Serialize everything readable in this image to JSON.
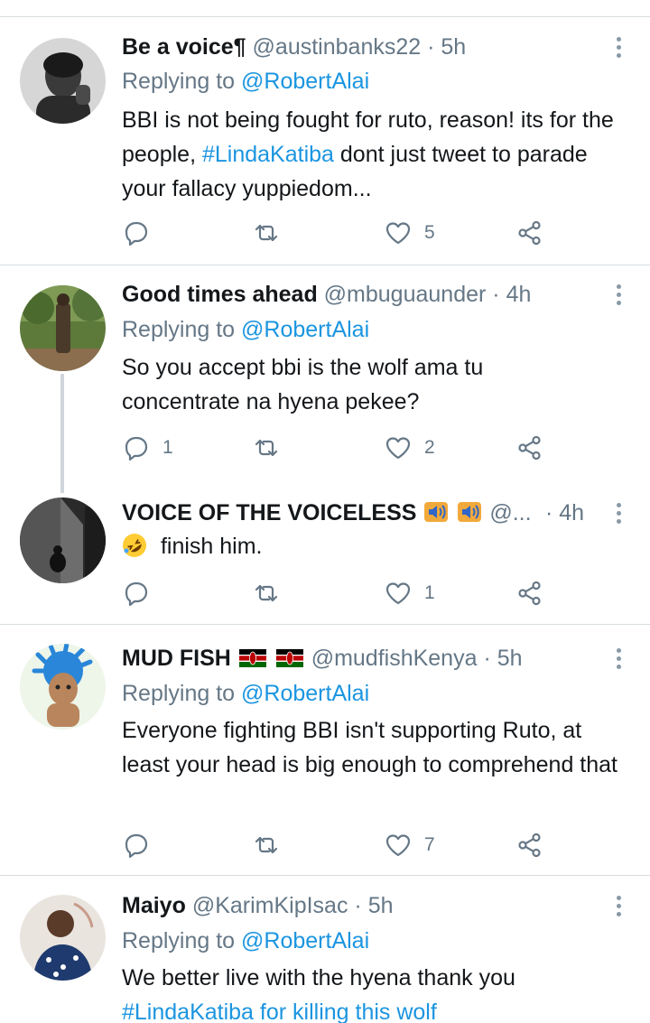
{
  "tweets": [
    {
      "name": "Be a voice¶",
      "handle": "@austinbanks22",
      "time": "5h",
      "reply_prefix": "Replying to",
      "reply_mention": "@RobertAlai",
      "text_1": "BBI is not being fought for ruto, reason! its for the people,",
      "hashtag": "#LindaKatiba",
      "text_2": "dont just tweet to parade your fallacy yuppiedom...",
      "likes": "5",
      "replies": "",
      "retweets": ""
    },
    {
      "name": "Good times ahead",
      "handle": "@mbuguaunder",
      "time": "4h",
      "reply_prefix": "Replying to",
      "reply_mention": "@RobertAlai",
      "text": "So you accept bbi is the wolf ama tu concentrate na hyena pekee?",
      "replies": "1",
      "retweets": "",
      "likes": "2"
    },
    {
      "name": "VOICE OF THE VOICELESS",
      "handle": "@...",
      "time": "4h",
      "text": "finish him.",
      "emoji": "rolling-on-floor-laughing",
      "replies": "",
      "retweets": "",
      "likes": "1"
    },
    {
      "name": "MUD FISH",
      "handle": "@mudfishKenya",
      "time": "5h",
      "reply_prefix": "Replying to",
      "reply_mention": "@RobertAlai",
      "text": "Everyone fighting BBI isn't supporting Ruto, at least your head is big enough to comprehend that",
      "replies": "",
      "retweets": "",
      "likes": "7"
    },
    {
      "name": "Maiyo",
      "handle": "@KarimKipIsac",
      "time": "5h",
      "reply_prefix": "Replying to",
      "reply_mention": "@RobertAlai",
      "text": "We better live with the hyena thank you",
      "text_cut": "#LindaKatiba for killing this wolf"
    }
  ],
  "colors": {
    "link": "#1b95e0",
    "secondary": "#657786",
    "icon": "#657786",
    "divider": "#d8dde1",
    "text": "#14171a"
  }
}
